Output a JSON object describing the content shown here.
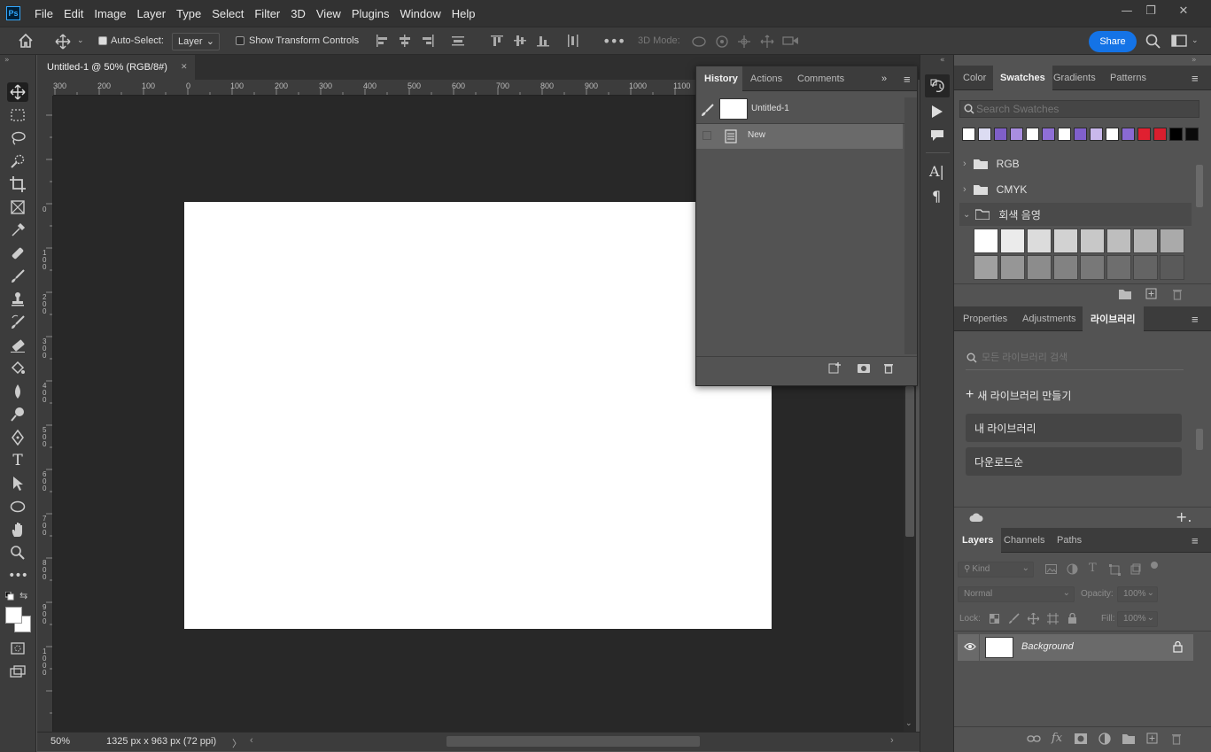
{
  "app": {
    "logo": "Ps"
  },
  "menu": [
    "File",
    "Edit",
    "Image",
    "Layer",
    "Type",
    "Select",
    "Filter",
    "3D",
    "View",
    "Plugins",
    "Window",
    "Help"
  ],
  "window_controls": {
    "minimize": "—",
    "restore": "❐",
    "close": "✕"
  },
  "options_bar": {
    "auto_select_label": "Auto-Select:",
    "auto_select_checked": true,
    "auto_select_target": "Layer",
    "show_transform_label": "Show Transform Controls",
    "show_transform_checked": false,
    "three_d_mode": "3D Mode:",
    "share_label": "Share"
  },
  "document": {
    "tab_title": "Untitled-1 @ 50% (RGB/8#)",
    "close": "✕",
    "zoom": "50%",
    "status_info": "1325 px x 963 px (72 ppi)",
    "status_arrow": "〉"
  },
  "rulers": {
    "horizontal": [
      "300",
      "200",
      "100",
      "0",
      "100",
      "200",
      "300",
      "400",
      "500",
      "600",
      "700",
      "800",
      "900",
      "1000",
      "1100"
    ],
    "vertical": [
      "0",
      "1 0 0",
      "2 0 0",
      "3 0 0",
      "4 0 0",
      "5 0 0",
      "6 0 0",
      "7 0 0",
      "8 0 0",
      "9 0 0",
      "1 0 0 0"
    ]
  },
  "history_panel": {
    "tabs": [
      "History",
      "Actions",
      "Comments"
    ],
    "active_tab": "History",
    "snapshot": "Untitled-1",
    "states": [
      "New"
    ]
  },
  "swatches_panel": {
    "tabs": [
      "Color",
      "Swatches",
      "Gradients",
      "Patterns"
    ],
    "active_tab": "Swatches",
    "search_placeholder": "Search Swatches",
    "recent": [
      "#ffffff",
      "#dcdcf2",
      "#7f5fc8",
      "#a98ee0",
      "#ffffff",
      "#8f6fd6",
      "#ffffff",
      "#8060cc",
      "#c9b8ec",
      "#ffffff",
      "#8a6ad2",
      "#e02030",
      "#d81e2e",
      "#000000",
      "#0a0a0a"
    ],
    "groups": [
      {
        "name": "RGB",
        "expanded": false
      },
      {
        "name": "CMYK",
        "expanded": false
      },
      {
        "name": "회색 음영",
        "expanded": true
      }
    ],
    "grays_row1": [
      "#ffffff",
      "#ebebeb",
      "#dcdcdc",
      "#d2d2d2",
      "#c8c8c8",
      "#bebebe",
      "#b4b4b4",
      "#aaaaaa"
    ],
    "grays_row2": [
      "#a0a0a0",
      "#969696",
      "#8c8c8c",
      "#828282",
      "#787878",
      "#6e6e6e",
      "#646464",
      "#5a5a5a"
    ]
  },
  "library_panel": {
    "tabs": [
      "Properties",
      "Adjustments",
      "라이브러리"
    ],
    "active_tab": "라이브러리",
    "search_placeholder": "모든 라이브러리 검색",
    "new_library": "새 라이브러리 만들기",
    "items": [
      "내 라이브러리",
      "다운로드순"
    ]
  },
  "layers_panel": {
    "tabs": [
      "Layers",
      "Channels",
      "Paths"
    ],
    "active_tab": "Layers",
    "filter_kind": "Kind",
    "blend_mode": "Normal",
    "opacity_label": "Opacity:",
    "opacity_value": "100%",
    "lock_label": "Lock:",
    "fill_label": "Fill:",
    "fill_value": "100%",
    "layers": [
      {
        "name": "Background",
        "visible": true,
        "locked": true
      }
    ]
  }
}
